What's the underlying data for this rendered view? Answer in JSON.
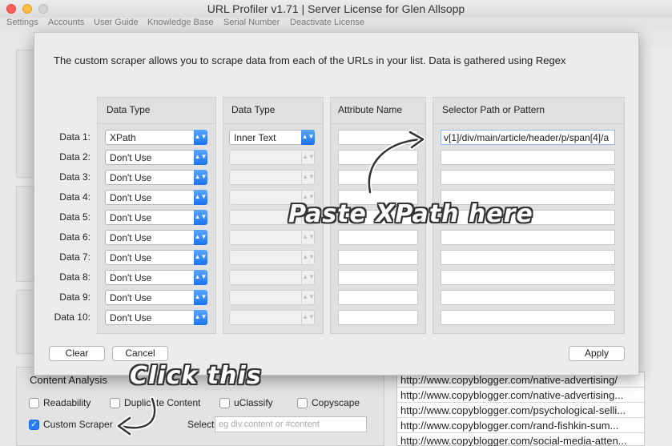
{
  "window": {
    "title": "URL Profiler v1.71 | Server License for Glen Allsopp"
  },
  "menu": [
    "Settings",
    "Accounts",
    "User Guide",
    "Knowledge Base",
    "Serial Number",
    "Deactivate License"
  ],
  "modal": {
    "intro": "The custom scraper allows you to scrape data from each of the URLs in your list. Data is gathered using Regex",
    "headers": {
      "data_type_1": "Data Type",
      "data_type_2": "Data Type",
      "attribute": "Attribute Name",
      "selector": "Selector Path or Pattern"
    },
    "rows": [
      {
        "label": "Data 1:",
        "type": "XPath",
        "subtype": "Inner Text",
        "attribute": "",
        "selector": "v[1]/div/main/article/header/p/span[4]/a"
      },
      {
        "label": "Data 2:",
        "type": "Don't Use",
        "subtype": "",
        "attribute": "",
        "selector": ""
      },
      {
        "label": "Data 3:",
        "type": "Don't Use",
        "subtype": "",
        "attribute": "",
        "selector": ""
      },
      {
        "label": "Data 4:",
        "type": "Don't Use",
        "subtype": "",
        "attribute": "",
        "selector": ""
      },
      {
        "label": "Data 5:",
        "type": "Don't Use",
        "subtype": "",
        "attribute": "",
        "selector": ""
      },
      {
        "label": "Data 6:",
        "type": "Don't Use",
        "subtype": "",
        "attribute": "",
        "selector": ""
      },
      {
        "label": "Data 7:",
        "type": "Don't Use",
        "subtype": "",
        "attribute": "",
        "selector": ""
      },
      {
        "label": "Data 8:",
        "type": "Don't Use",
        "subtype": "",
        "attribute": "",
        "selector": ""
      },
      {
        "label": "Data 9:",
        "type": "Don't Use",
        "subtype": "",
        "attribute": "",
        "selector": ""
      },
      {
        "label": "Data 10:",
        "type": "Don't Use",
        "subtype": "",
        "attribute": "",
        "selector": ""
      }
    ],
    "clear_label": "Clear",
    "cancel_label": "Cancel",
    "apply_label": "Apply"
  },
  "annotations": {
    "paste": "Paste XPath here",
    "click": "Click this"
  },
  "content_analysis": {
    "title": "Content Analysis",
    "options": [
      {
        "label": "Readability",
        "checked": false
      },
      {
        "label": "Duplicate Content",
        "checked": false
      },
      {
        "label": "uClassify",
        "checked": false
      },
      {
        "label": "Copyscape",
        "checked": false
      },
      {
        "label": "Custom Scraper",
        "checked": true
      }
    ],
    "selector_label": "Selector:",
    "selector_placeholder": "eg div.content or #content"
  },
  "url_list": [
    "http://www.copyblogger.com/native-advertising/",
    "http://www.copyblogger.com/native-advertising...",
    "http://www.copyblogger.com/psychological-selli...",
    "http://www.copyblogger.com/rand-fishkin-sum...",
    "http://www.copyblogger.com/social-media-atten..."
  ],
  "colors": {
    "accent": "#2a7ef3",
    "annotation_text": "#ffffff",
    "annotation_outline": "#333333"
  }
}
